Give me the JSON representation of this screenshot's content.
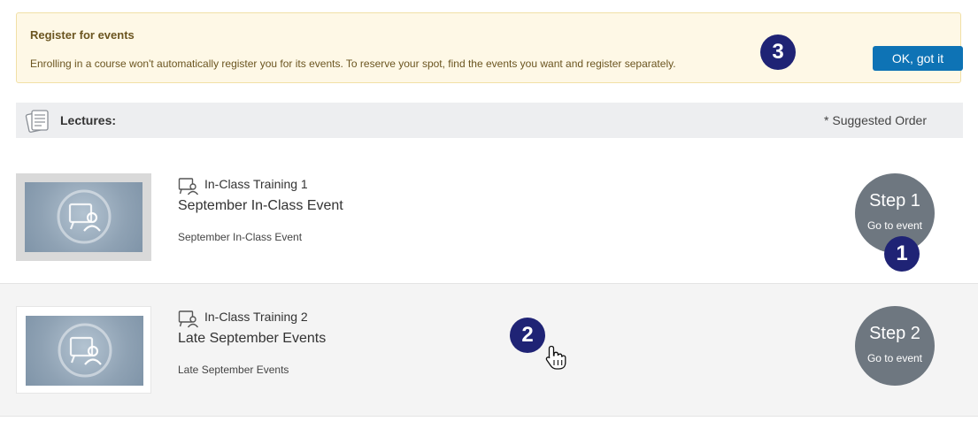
{
  "banner": {
    "title": "Register for events",
    "message": "Enrolling in a course won't automatically register you for its events. To reserve your spot, find the events you want and register separately.",
    "button_label": "OK, got it"
  },
  "lectures": {
    "label": "Lectures:",
    "suggested_order": "* Suggested Order"
  },
  "events": [
    {
      "type_label": "In-Class Training 1",
      "title": "September In-Class Event",
      "description": "September In-Class Event",
      "step": "Step 1",
      "step_action": "Go to event"
    },
    {
      "type_label": "In-Class Training 2",
      "title": "Late September Events",
      "description": "Late September Events",
      "step": "Step 2",
      "step_action": "Go to event"
    }
  ],
  "annotations": {
    "badge_1": "1",
    "badge_2": "2",
    "badge_3": "3"
  },
  "colors": {
    "banner_bg": "#fef8e6",
    "button_blue": "#0e73b5",
    "step_circle": "#6e7780",
    "badge_navy": "#1f2375",
    "section_bar": "#edeef0"
  },
  "icons": {
    "lectures": "document-stack-icon",
    "event_type": "classroom-presenter-icon",
    "thumbnail": "classroom-presenter-icon",
    "cursor": "hand-pointer-cursor-icon"
  }
}
